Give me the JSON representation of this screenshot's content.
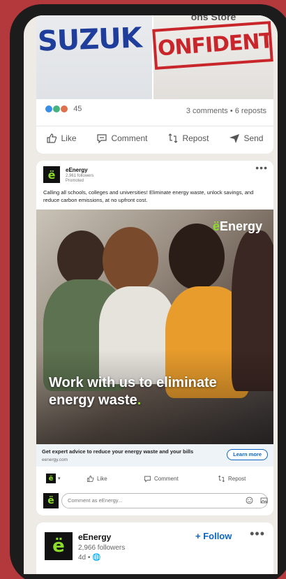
{
  "post1": {
    "image_left_text": "SUZUK",
    "image_right_top_text": "ons Store",
    "image_right_stamp": "ONFIDENTIAL",
    "reaction_count": "45",
    "comments_reposts": "3 comments • 6 reposts",
    "actions": {
      "like": "Like",
      "comment": "Comment",
      "repost": "Repost",
      "send": "Send"
    }
  },
  "post2": {
    "logo_letter": "ë",
    "company": "eEnergy",
    "followers": "2,961 followers",
    "promoted": "Promoted",
    "text": "Calling all schools, colleges and universities! Eliminate energy waste, unlock savings, and reduce carbon emissions, at no upfront cost.",
    "hero_brand_mark": "ë",
    "hero_brand": "Energy",
    "hero_headline": "Work with us to eliminate energy waste",
    "hero_headline_period": ".",
    "cta_title": "Get expert advice to reduce your energy waste and your bills",
    "cta_url": "eenergy.com",
    "cta_button": "Learn more",
    "actions": {
      "like": "Like",
      "comment": "Comment",
      "repost": "Repost"
    },
    "comment_placeholder": "Comment as eEnergy..."
  },
  "post3": {
    "logo_letter": "ë",
    "company": "eEnergy",
    "followers": "2,966 followers",
    "time": "4d •",
    "follow_label": "+ Follow"
  },
  "colors": {
    "background": "#b3393d",
    "brand_green": "#8ddb2b",
    "linkedin_blue": "#0a66c2"
  }
}
